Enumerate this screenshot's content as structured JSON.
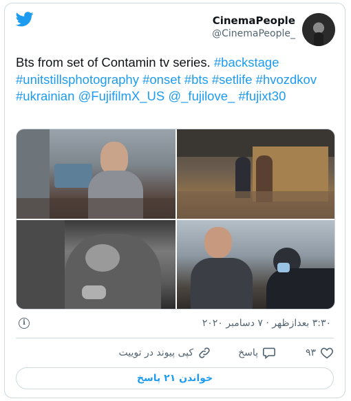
{
  "user": {
    "display_name": "CinemaPeople",
    "handle": "@CinemaPeople_"
  },
  "tweet": {
    "text_parts": [
      {
        "text": "Bts from set of Contamin tv series.  ",
        "kind": "plain"
      },
      {
        "text": "#backstage",
        "kind": "tag"
      },
      {
        "text": " ",
        "kind": "plain"
      },
      {
        "text": "#unitstillsphotography",
        "kind": "tag"
      },
      {
        "text": " ",
        "kind": "plain"
      },
      {
        "text": "#onset",
        "kind": "tag"
      },
      {
        "text": " ",
        "kind": "plain"
      },
      {
        "text": "#bts",
        "kind": "tag"
      },
      {
        "text": " ",
        "kind": "plain"
      },
      {
        "text": "#setlife",
        "kind": "tag"
      },
      {
        "text": " ",
        "kind": "plain"
      },
      {
        "text": "#hvozdkov",
        "kind": "tag"
      },
      {
        "text": " ",
        "kind": "plain"
      },
      {
        "text": "#ukrainian",
        "kind": "tag"
      },
      {
        "text": " ",
        "kind": "plain"
      },
      {
        "text": "@FujifilmX_US",
        "kind": "tag"
      },
      {
        "text": "  ",
        "kind": "plain"
      },
      {
        "text": "@_fujilove_",
        "kind": "tag"
      },
      {
        "text": " ",
        "kind": "plain"
      },
      {
        "text": "#fujixt30",
        "kind": "tag"
      }
    ],
    "timestamp": "۳:۳۰ بعدازظهر · ۷ دسامبر ۲۰۲۰"
  },
  "actions": {
    "like_count": "۹۳",
    "reply_label": "پاسخ",
    "copy_link_label": "کپی پیوند در توییت"
  },
  "replies_button": "خواندن ۲۱ پاسخ",
  "icons": {
    "brand": "twitter-bird-icon",
    "info": "info-icon",
    "like": "heart-icon",
    "reply": "reply-bubble-icon",
    "copy": "link-icon"
  },
  "colors": {
    "accent": "#1d9bf0",
    "muted": "#536471",
    "border": "#cfd9de"
  }
}
